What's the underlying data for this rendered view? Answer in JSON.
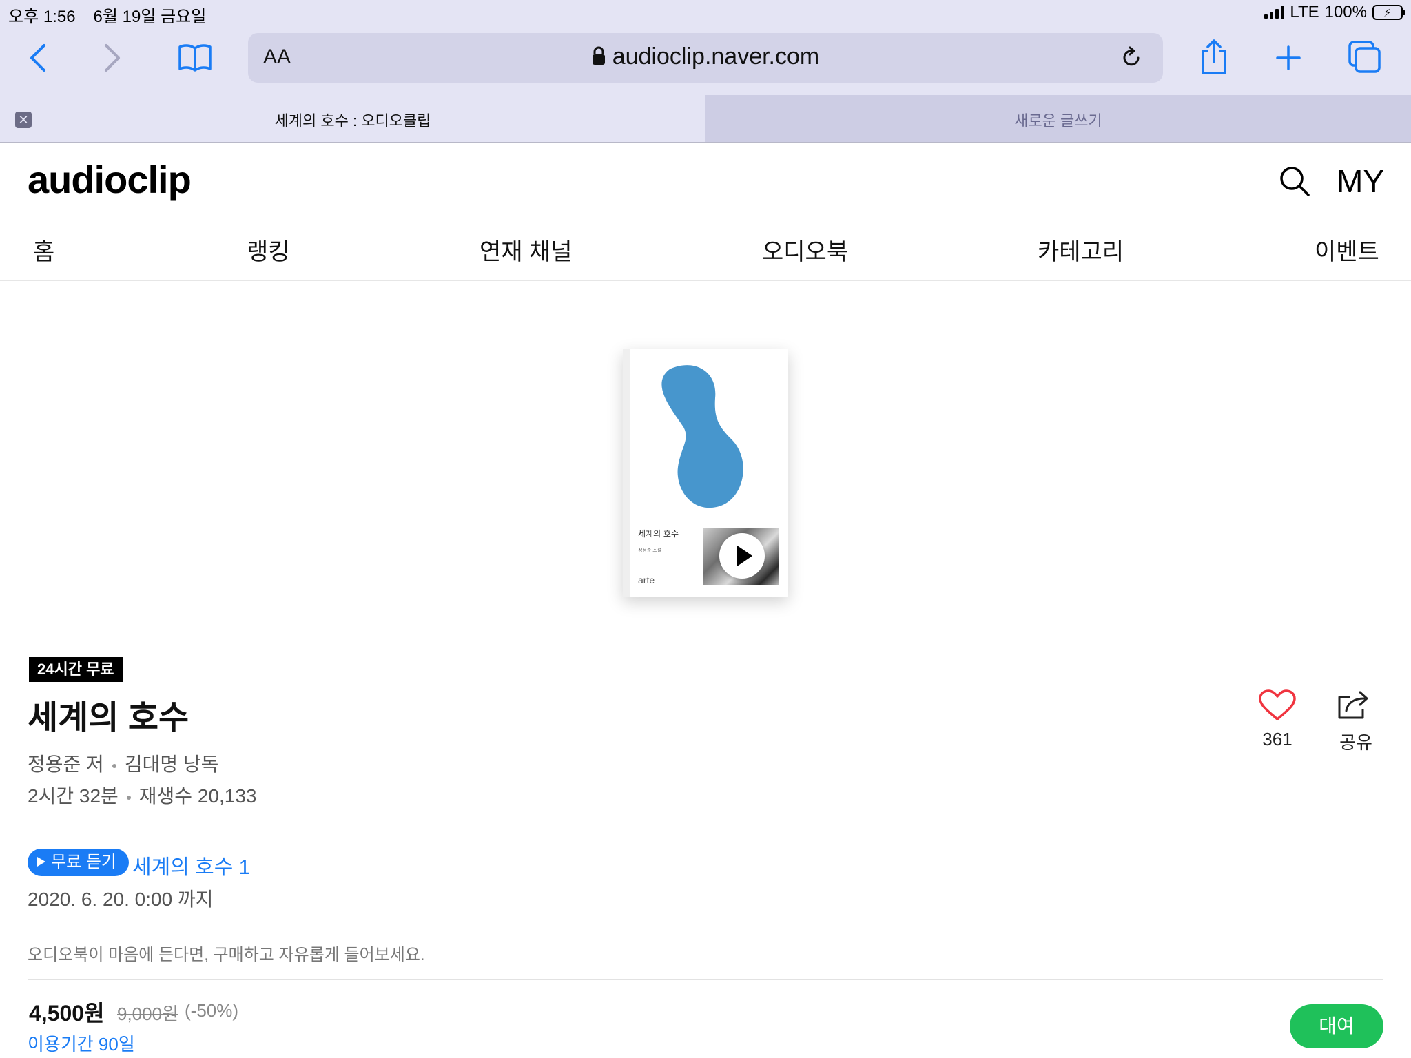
{
  "status_bar": {
    "time": "오후 1:56",
    "date": "6월 19일 금요일",
    "network": "LTE",
    "battery": "100%"
  },
  "browser": {
    "url_aa": "AA",
    "url": "audioclip.naver.com",
    "tabs": [
      {
        "title": "세계의 호수 : 오디오클립",
        "active": true
      },
      {
        "title": "새로운 글쓰기",
        "active": false
      }
    ],
    "accent_color": "#1a7cf5"
  },
  "site": {
    "logo": "audioclip",
    "my_label": "MY",
    "nav": [
      "홈",
      "랭킹",
      "연재 채널",
      "오디오북",
      "카테고리",
      "이벤트"
    ]
  },
  "cover": {
    "title": "세계의 호수",
    "subtitle": "정용준 소설",
    "publisher": "arte",
    "blob_color": "#4796cd"
  },
  "book": {
    "badge": "24시간 무료",
    "title": "세계의 호수",
    "author": "정용준 저",
    "narrator": "김대명 낭독",
    "duration": "2시간 32분",
    "plays": "재생수 20,133",
    "likes": "361",
    "share_label": "공유"
  },
  "free_listen": {
    "button_label": "무료 듣기",
    "episode": "세계의 호수 1",
    "until": "2020. 6. 20. 0:00 까지"
  },
  "purchase": {
    "notice": "오디오북이 마음에 든다면, 구매하고 자유롭게 들어보세요.",
    "price": "4,500원",
    "original_price": "9,000원",
    "discount": "(-50%)",
    "period": "이용기간 90일",
    "rent_label": "대여",
    "rent_color": "#1fc15a"
  }
}
